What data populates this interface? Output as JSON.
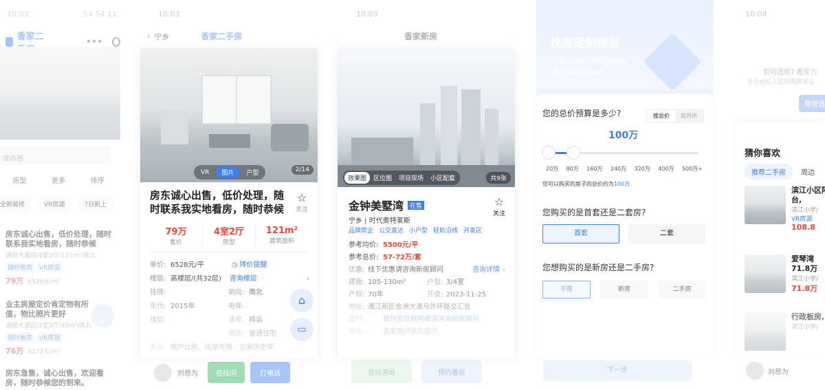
{
  "screen1": {
    "status_time": "10:03",
    "status_right": "54 54 11",
    "app_title": "香家二手房",
    "search_placeholder": "或商圈",
    "filters": [
      "房型",
      "更多",
      "排序"
    ],
    "chips": [
      "全新装修",
      "VR房源",
      "7日新上"
    ],
    "listings": [
      {
        "title": "房东诚心出售，低价处理，随时联系我实地看房，随时恭候",
        "meta": "通程大酒店/4室2厅/121m²/南北",
        "tags": [
          "随时看房",
          "VR房源"
        ],
        "price": "79万",
        "unit_price": "6528元/m²"
      },
      {
        "title": "业主房屋定价肯定物有所值，物比照片更好",
        "meta": "通程大酒店/3室2厅/93m²/南北",
        "tags": [
          "随时看房",
          "VR房源"
        ],
        "price": "76万",
        "unit_price": "8172元/m²"
      },
      {
        "title": "房东急售，诚心出售，欢迎看房，随时恭候您的到来。",
        "meta": "",
        "tags": [],
        "price": "",
        "unit_price": ""
      }
    ]
  },
  "screen2": {
    "status_time": "10:03",
    "nav_back": "宁乡",
    "app_title": "香家二手房",
    "media_tabs": [
      "VR",
      "图片",
      "户型"
    ],
    "photo_counter": "2/14",
    "title": "房东诚心出售，低价处理，随时联系我实地看房，随时恭候",
    "follow_label": "关注",
    "stats": [
      {
        "value": "79万",
        "label": "售价"
      },
      {
        "value": "4室2厅",
        "label": "房型"
      },
      {
        "value": "121m²",
        "label": "建筑面积"
      }
    ],
    "unit_price_label": "单价:",
    "unit_price_value": "6528元/平",
    "price_alert": "降价提醒",
    "floor_label": "楼层:",
    "floor_value": "高楼层/(共32层)",
    "ask_floor": "咨询楼层",
    "listed_label": "挂牌:",
    "orientation_label": "朝向:",
    "orientation_value": "南北",
    "year_label": "年代:",
    "year_value": "2015年",
    "elevator_label": "电梯:",
    "floor_type_label": "楼层:",
    "decoration_label": "装修:",
    "decoration_value": "精装",
    "usage_label": "用途:",
    "usage_value": "普通住宅",
    "more_label": "更多:",
    "more_value": "梯户比例、房屋年限、交易历史等",
    "agent_name": "刘慈为",
    "btn_online": "在线问",
    "btn_call": "打电话"
  },
  "screen3": {
    "status_time": "10:03",
    "app_title": "香家新房",
    "photo_tabs": [
      "效果图",
      "区位图",
      "项目现场",
      "小区配套"
    ],
    "photo_count": "共9张",
    "title": "金钟美墅湾",
    "status_badge": "在售",
    "subtitle": "宁乡 | 时代奥特莱斯",
    "tags": [
      "品牌房企",
      "公交直达",
      "小户型",
      "轻轨沿线",
      "开发区"
    ],
    "follow_label": "关注",
    "avg_price_label": "参考均价:",
    "avg_price_value": "5500元/平",
    "total_price_label": "参考总价:",
    "total_price_value": "57-72万/套",
    "discount_label": "优惠:",
    "discount_value": "线下优惠请咨询新房顾问",
    "discount_link": "咨询详情",
    "area_label": "建面:",
    "area_value": "105-130m²",
    "layout_label": "户型:",
    "layout_value": "3/4室",
    "years_label": "产权:",
    "years_value": "70年",
    "open_label": "开盘:",
    "open_value": "2023-11-25",
    "address_label": "地址:",
    "address_value": "湘江新区金洲大道与外环路交汇处",
    "service_label": "首付:",
    "service_value": "首付及贷款明细请咨询新房顾问",
    "risk_label": "服务:",
    "risk_value": "香家用户风险提示",
    "btn_left": "在线咨询",
    "btn_right": "预约看房"
  },
  "screen4": {
    "header_title": "找房定制楼层",
    "header_lines": [
      "已有10000+用户完成定制",
      "精准推荐匹配好房"
    ],
    "q1": "您的总价预算是多少?",
    "toggle": [
      "按总价",
      "按月供"
    ],
    "budget_value": "100万",
    "ticks": [
      "20万",
      "80万",
      "160万",
      "240万",
      "320万",
      "400万",
      "500万+"
    ],
    "budget_note_prefix": "您可以购买的房子的总价约为",
    "budget_note_value": "100万",
    "q2": "您购买的是首套还是二套房?",
    "q2_options": [
      "首套",
      "二套"
    ],
    "q3": "您想购买的是新房还是二手房?",
    "q3_options": [
      "不限",
      "新房",
      "二手房"
    ],
    "submit": "下一步"
  },
  "screen5": {
    "status_time": "10:04",
    "banner_q": "如何选房? 香家为",
    "banner_sub": "专业经纪人提供购房建议",
    "banner_btn": "帮我选",
    "section_title": "猜你喜欢",
    "tabs": [
      "推荐二手房",
      "周边"
    ],
    "listings": [
      {
        "title": "滨江小区阳台,",
        "meta": "滨江小学/",
        "tags": [
          "VR房源"
        ],
        "price": "108.8"
      },
      {
        "title": "爱琴湾71.8万",
        "meta": "滨江小学/",
        "tags": [],
        "price": "71.8万"
      },
      {
        "title": "行政板房,",
        "meta": "滨江小学/",
        "tags": [],
        "price": ""
      }
    ],
    "agent_name": "刘慈为"
  },
  "colors": {
    "accent_blue": "#3b7ff0",
    "price_red": "#e8463b",
    "bg": "#ffffff"
  }
}
